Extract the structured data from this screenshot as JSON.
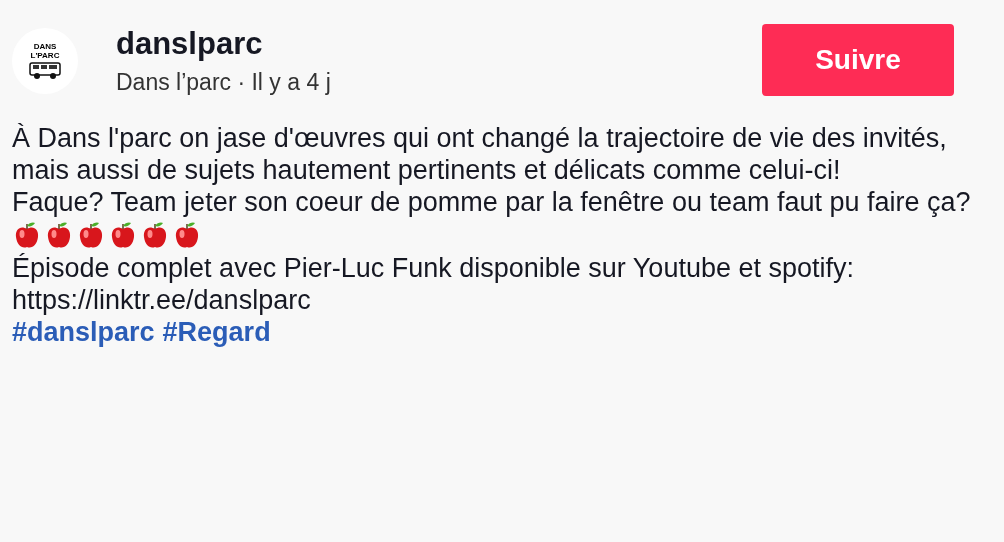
{
  "author": {
    "logo_lines": [
      "DANS",
      "L'PARC"
    ],
    "username": "danslparc",
    "subtitle": "Dans l’parc · Il y a 4 j"
  },
  "follow_button": {
    "label": "Suivre"
  },
  "caption": {
    "paragraphs": [
      "À Dans l'parc on jase d'œuvres qui ont changé la trajectoire de vie des invités, mais aussi de sujets hautement pertinents et délicats comme celui-ci!",
      "Faque? Team jeter son coeur de pomme par la fenêtre ou team faut pu faire ça?"
    ],
    "emoji": [
      {
        "kind": "apple"
      },
      {
        "kind": "apple"
      },
      {
        "kind": "apple"
      },
      {
        "kind": "apple"
      },
      {
        "kind": "apple"
      },
      {
        "kind": "apple"
      }
    ],
    "after": [
      "Épisode complet avec Pier-Luc Funk disponible sur Youtube et spotify: https://linktr.ee/danslparc"
    ],
    "hashtags": [
      "#danslparc",
      "#Regard"
    ]
  }
}
